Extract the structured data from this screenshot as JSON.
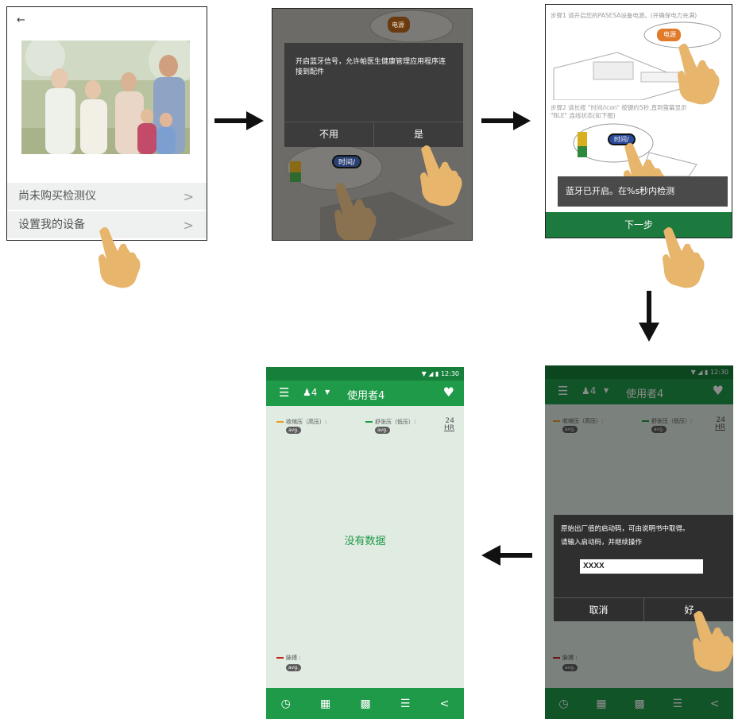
{
  "screen1": {
    "back_icon": "arrow-left-icon",
    "rows": [
      {
        "label": "尚未购买检测仪",
        "chevron": ">"
      },
      {
        "label": "设置我的设备",
        "chevron": ">"
      }
    ]
  },
  "screen2": {
    "device_label_top": "电源",
    "device_label_bottom": "时间/",
    "dialog_message": "开启蓝牙信号，允许帕医生健康管理应用程序连接到配件",
    "buttons": {
      "cancel": "不用",
      "ok": "是"
    }
  },
  "screen3": {
    "step1": "步骤1 请开启您的PASESA设备电源。(并确保电力充满)",
    "step2_line1": "步骤2 请长按 \"时间/icon\" 按键约5秒,直到萤幕显示",
    "step2_line2": "\"BLE\" 连线状态(如下图)",
    "device_label_top": "电源",
    "device_label_bottom": "时间/",
    "toast": "蓝牙已开启。在%s秒内检测",
    "next_button": "下一步"
  },
  "phone": {
    "time": "12:30",
    "user_num": "4",
    "title": "使用者4",
    "systolic": "收缩压（高压）:",
    "diastolic": "舒张压（低压）:",
    "pulse": "脉搏 :",
    "avg": "avg.",
    "hr24": "24",
    "hr24_unit": "HR",
    "no_data": "没有数据"
  },
  "screen4": {
    "dialog_line1": "原始出厂值的启动码，可由说明书中取得。",
    "dialog_line2": "请输入启动码，并继续操作",
    "input_value": "XXXX",
    "buttons": {
      "cancel": "取消",
      "ok": "好"
    }
  },
  "colors": {
    "green": "#1f9a48",
    "dark_green": "#16803a",
    "systolic": "#e89a1c",
    "diastolic": "#1f9a48",
    "pulse": "#c0261e",
    "hand": "#e7b56c"
  }
}
